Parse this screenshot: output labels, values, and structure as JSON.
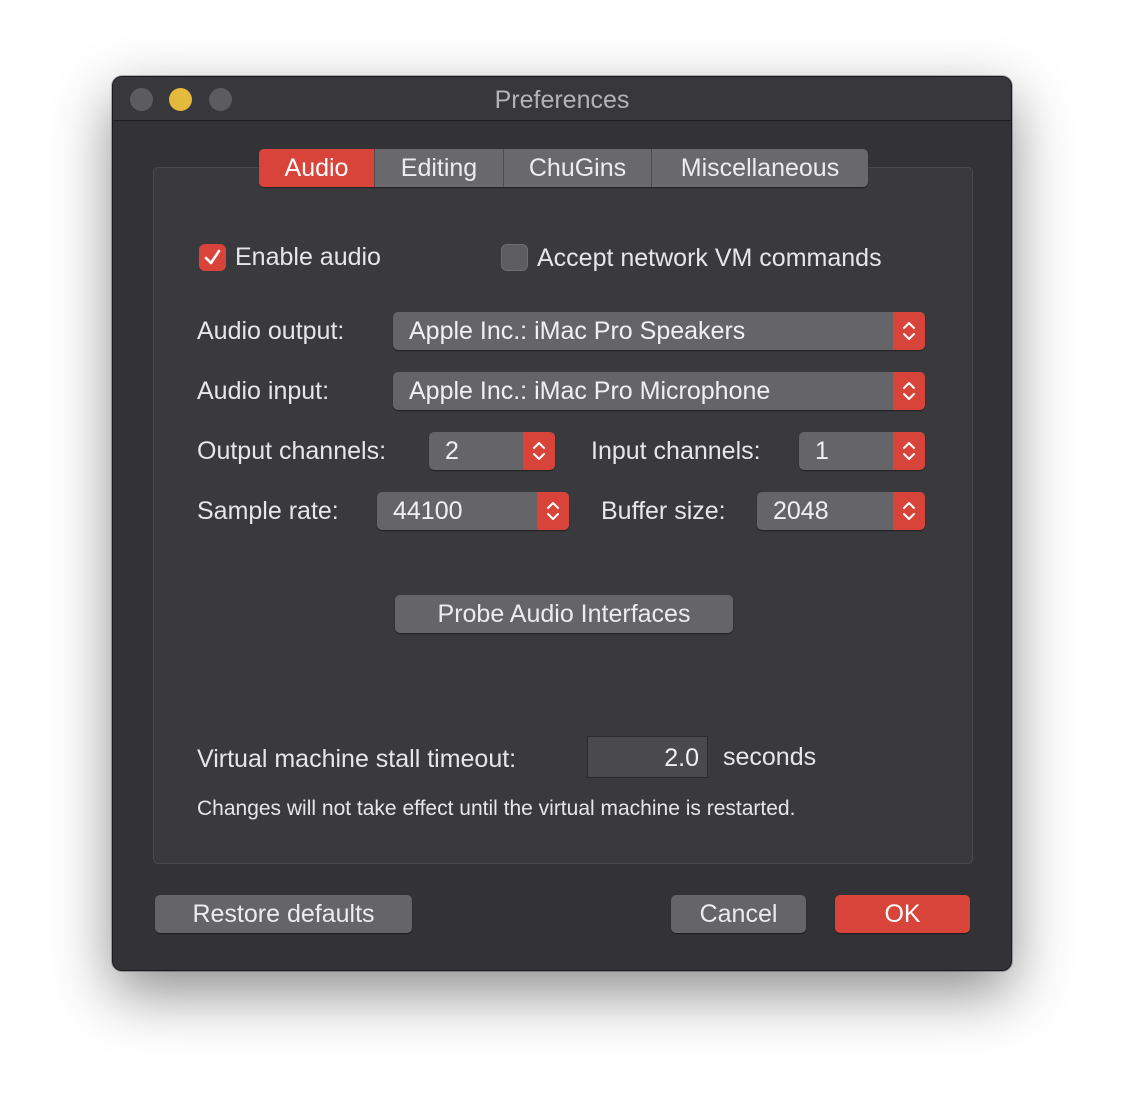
{
  "window": {
    "title": "Preferences"
  },
  "tabs": [
    {
      "label": "Audio",
      "active": true
    },
    {
      "label": "Editing",
      "active": false
    },
    {
      "label": "ChuGins",
      "active": false
    },
    {
      "label": "Miscellaneous",
      "active": false
    }
  ],
  "audio": {
    "enable_audio": {
      "label": "Enable audio",
      "checked": true
    },
    "accept_network": {
      "label": "Accept network VM commands",
      "checked": false
    },
    "output": {
      "label": "Audio output:",
      "value": "Apple Inc.: iMac Pro Speakers"
    },
    "input": {
      "label": "Audio input:",
      "value": "Apple Inc.: iMac Pro Microphone"
    },
    "output_channels": {
      "label": "Output channels:",
      "value": "2"
    },
    "input_channels": {
      "label": "Input channels:",
      "value": "1"
    },
    "sample_rate": {
      "label": "Sample rate:",
      "value": "44100"
    },
    "buffer_size": {
      "label": "Buffer size:",
      "value": "2048"
    },
    "probe_button": "Probe Audio Interfaces",
    "stall_timeout": {
      "label": "Virtual machine stall timeout:",
      "value": "2.0",
      "unit": "seconds"
    },
    "restart_note": "Changes will not take effect until the virtual machine is restarted."
  },
  "footer": {
    "restore_defaults": "Restore defaults",
    "cancel": "Cancel",
    "ok": "OK"
  },
  "colors": {
    "accent": "#d9443a",
    "window_bg": "#333236",
    "control_bg": "#656469"
  }
}
